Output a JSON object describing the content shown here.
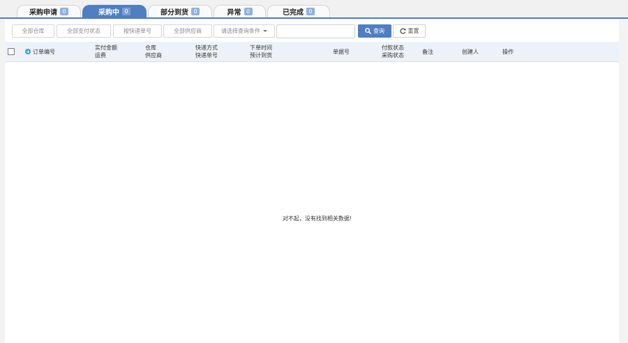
{
  "tabs": [
    {
      "label": "采购申请",
      "count": "0",
      "active": false
    },
    {
      "label": "采购中",
      "count": "0",
      "active": true
    },
    {
      "label": "部分到货",
      "count": "0",
      "active": false
    },
    {
      "label": "异常",
      "count": "0",
      "active": false
    },
    {
      "label": "已完成",
      "count": "0",
      "active": false
    }
  ],
  "filters": {
    "warehouse": "全部仓库",
    "payment_status": "全部支付状态",
    "express_placeholder": "按快递单号",
    "supplier": "全部供应商",
    "condition": "请选择查询条件"
  },
  "search": {
    "value": "",
    "placeholder": ""
  },
  "buttons": {
    "query": "查询",
    "reset": "重置"
  },
  "columns": {
    "order_no": "订单编号",
    "amount": [
      "实付金额",
      "运费"
    ],
    "warehouse": [
      "仓库",
      "供应商"
    ],
    "shipping": [
      "快递方式",
      "快递单号"
    ],
    "time": [
      "下单时间",
      "预计到货"
    ],
    "bill_no": "单据号",
    "status": [
      "付款状态",
      "采购状态"
    ],
    "remark": "备注",
    "creator": "创建人",
    "action": "操作"
  },
  "empty_message": "对不起，没有找到相关数据!",
  "colors": {
    "accent": "#4f7ec2",
    "header_bg": "#edf2f8",
    "badge": "#8fb0dc"
  }
}
